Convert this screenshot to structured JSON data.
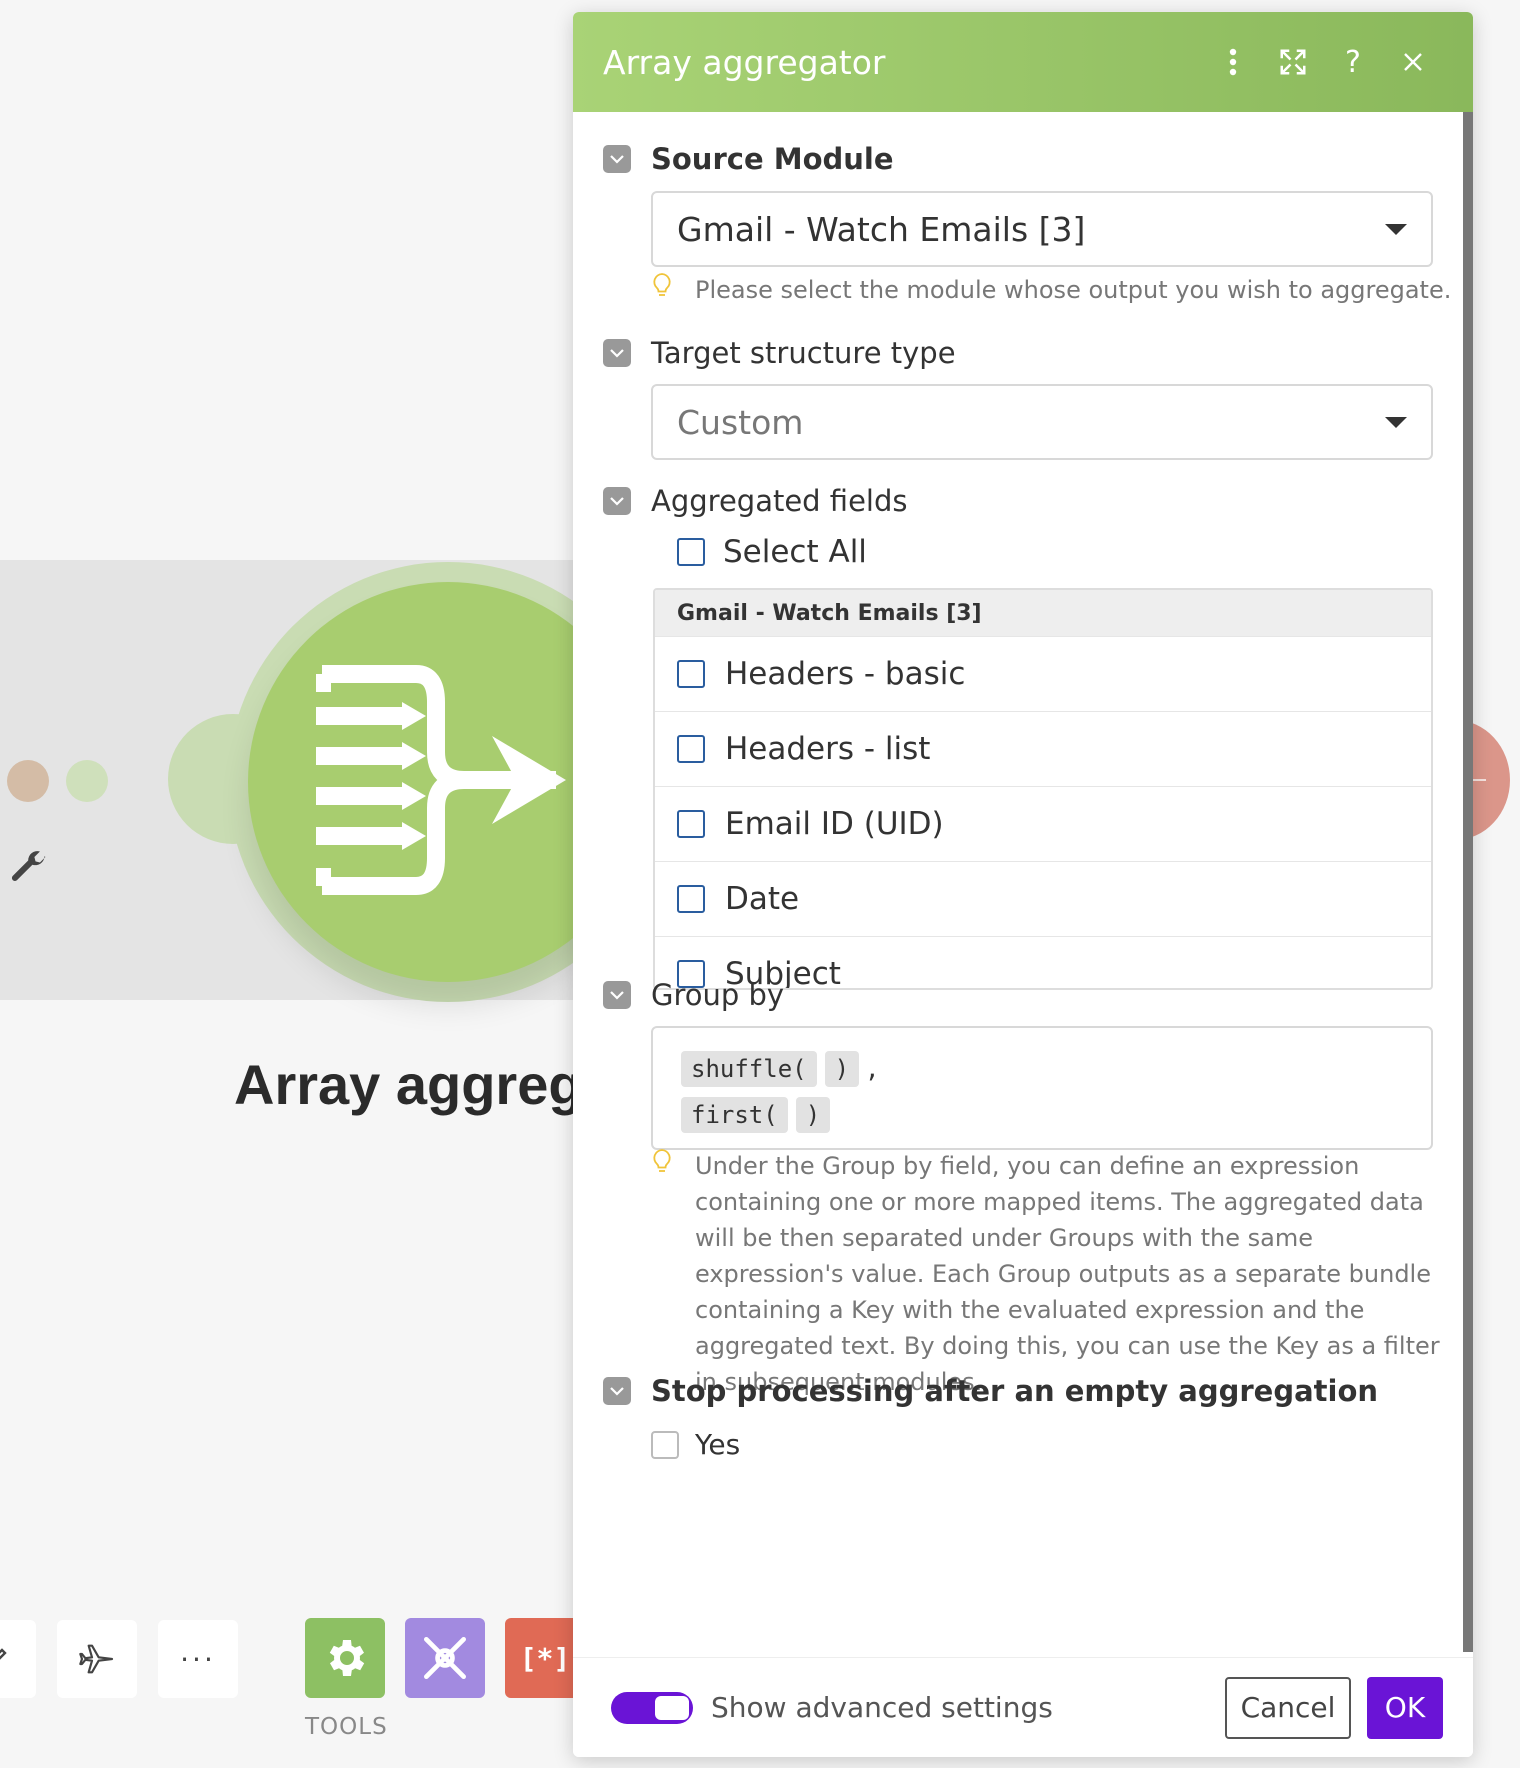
{
  "canvas": {
    "module_title": "Array aggrega",
    "tools_label": "TOOLS",
    "toolbar_more": "···",
    "tool_icons": [
      "gear-icon",
      "tools-icon",
      "array-icon"
    ]
  },
  "dialog": {
    "title": "Array aggregator",
    "header_icons": [
      "more-vert-icon",
      "expand-icon",
      "help-icon",
      "close-icon"
    ],
    "source_module": {
      "label": "Source Module",
      "value": "Gmail - Watch Emails [3]",
      "hint": "Please select the module whose output you wish to aggregate."
    },
    "target_structure": {
      "label": "Target structure type",
      "value": "Custom"
    },
    "aggregated_fields": {
      "label": "Aggregated fields",
      "select_all": "Select All",
      "group_header": "Gmail - Watch Emails [3]",
      "items": [
        "Headers - basic",
        "Headers - list",
        "Email ID (UID)",
        "Date",
        "Subject"
      ]
    },
    "group_by": {
      "label": "Group by",
      "line1_fn": "shuffle(",
      "line1_close": ")",
      "line1_sep": ",",
      "line2_fn": "first(",
      "line2_close": ")",
      "hint": "Under the Group by field, you can define an expression containing one or more mapped items. The aggregated data will be then separated under Groups with the same expression's value. Each Group outputs as a separate bundle containing a Key with the evaluated expression and the aggregated text. By doing this, you can use the Key as a filter in subsequent modules."
    },
    "stop_processing": {
      "label": "Stop processing after an empty aggregation",
      "option": "Yes"
    },
    "footer": {
      "advanced_label": "Show advanced settings",
      "cancel": "Cancel",
      "ok": "OK"
    }
  },
  "colors": {
    "header_green": "#a9d376",
    "module_green": "#a8cd6f",
    "accent_purple": "#6a14d6",
    "checkbox_blue": "#2a5d9f"
  }
}
